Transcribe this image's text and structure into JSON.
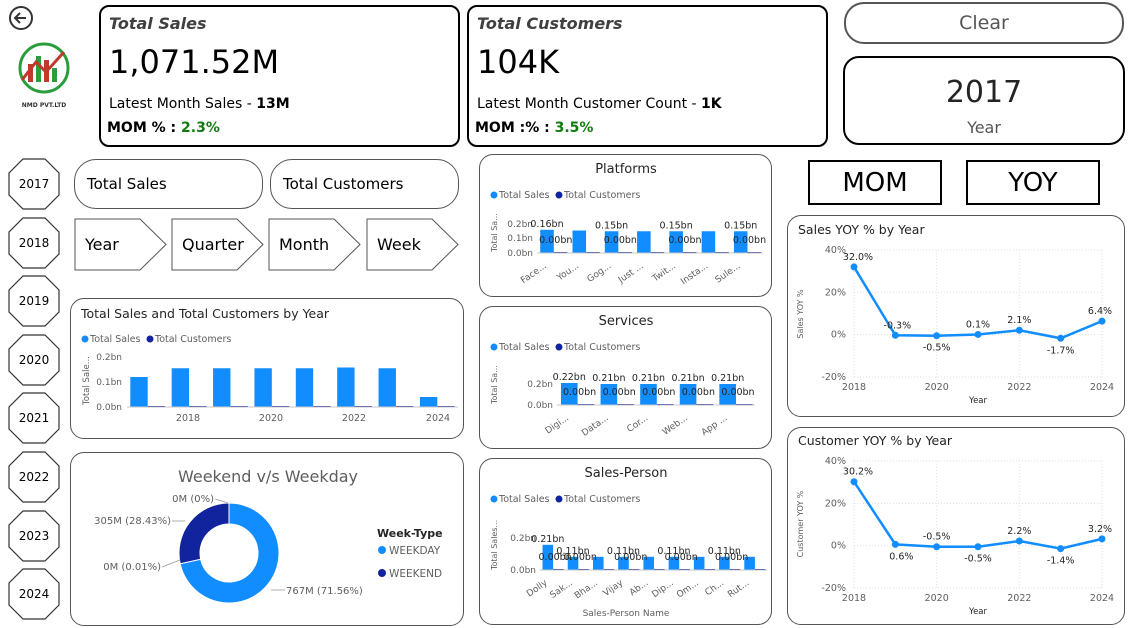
{
  "back_icon": "back-arrow-icon",
  "logo": {
    "text": "NMD PVT.LTD"
  },
  "kpi_sales": {
    "title": "Total Sales",
    "value": "1,071.52M",
    "sub_label": "Latest Month Sales - ",
    "sub_value": "13M",
    "mom_label": "MOM % : ",
    "mom_value": "2.3%"
  },
  "kpi_customers": {
    "title": "Total Customers",
    "value": "104K",
    "sub_label": "Latest Month Customer Count - ",
    "sub_value": "1K",
    "mom_label": "MOM :% : ",
    "mom_value": "3.5%"
  },
  "clear_label": "Clear",
  "year_card": {
    "value": "2017",
    "label": "Year"
  },
  "years": [
    "2017",
    "2018",
    "2019",
    "2020",
    "2021",
    "2022",
    "2023",
    "2024"
  ],
  "measure_buttons": [
    "Total Sales",
    "Total Customers"
  ],
  "period_buttons": [
    "Year",
    "Quarter",
    "Month",
    "Week"
  ],
  "mom_label": "MOM",
  "yoy_label": "YOY",
  "colors": {
    "sales": "#118DFF",
    "customers": "#12239E"
  },
  "legend": {
    "sales": "Total Sales",
    "customers": "Total Customers"
  },
  "chart_data": [
    {
      "id": "by_year",
      "type": "bar",
      "title": "Total Sales and Total Customers by Year",
      "ylabel": "Total Sale...",
      "yticks": [
        "0.2bn",
        "0.1bn",
        "0.0bn"
      ],
      "xticks": [
        "2018",
        "2020",
        "2022",
        "2024"
      ],
      "categories": [
        "2017",
        "2018",
        "2019",
        "2020",
        "2021",
        "2022",
        "2023",
        "2024"
      ],
      "series": [
        {
          "name": "Total Sales",
          "values": [
            0.12,
            0.155,
            0.155,
            0.155,
            0.155,
            0.158,
            0.155,
            0.04
          ]
        },
        {
          "name": "Total Customers",
          "values": [
            0.001,
            0.001,
            0.001,
            0.001,
            0.001,
            0.001,
            0.001,
            0.001
          ]
        }
      ],
      "ylim": [
        0,
        0.2
      ]
    },
    {
      "id": "platforms",
      "type": "bar",
      "title": "Platforms",
      "ylabel": "Total Sa...",
      "yticks": [
        "0.2bn",
        "0.1bn",
        "0.0bn"
      ],
      "categories": [
        "Face...",
        "You...",
        "Gog...",
        "Just ...",
        "Twit...",
        "Insta...",
        "Sule..."
      ],
      "sales_labels": [
        "0.16bn",
        "0.15bn",
        "0.15bn",
        "0.15bn"
      ],
      "cust_labels": [
        "0.00bn",
        "0.00bn",
        "0.00bn",
        "0.00bn"
      ],
      "series": [
        {
          "name": "Total Sales",
          "values": [
            0.16,
            0.155,
            0.15,
            0.15,
            0.15,
            0.15,
            0.15
          ]
        },
        {
          "name": "Total Customers",
          "values": [
            0.001,
            0.001,
            0.001,
            0.001,
            0.001,
            0.001,
            0.001
          ]
        }
      ],
      "ylim": [
        0,
        0.2
      ]
    },
    {
      "id": "services",
      "type": "bar",
      "title": "Services",
      "ylabel": "Total Sa...",
      "yticks": [
        "0.2bn",
        "0.0bn"
      ],
      "categories": [
        "Digi...",
        "Data...",
        "Cor...",
        "Web...",
        "App ..."
      ],
      "sales_labels": [
        "0.22bn",
        "0.21bn",
        "0.21bn",
        "0.21bn",
        "0.21bn"
      ],
      "cust_labels": [
        "0.00bn",
        "0.00bn",
        "0.00bn",
        "0.00bn",
        "0.00bn"
      ],
      "series": [
        {
          "name": "Total Sales",
          "values": [
            0.22,
            0.21,
            0.21,
            0.21,
            0.21
          ]
        },
        {
          "name": "Total Customers",
          "values": [
            0.001,
            0.001,
            0.001,
            0.001,
            0.001
          ]
        }
      ],
      "ylim": [
        0,
        0.25
      ]
    },
    {
      "id": "sales_person",
      "type": "bar",
      "title": "Sales-Person",
      "ylabel": "Total Sales...",
      "xlabel": "Sales-Person Name",
      "yticks": [
        "0.2bn",
        "0.0bn"
      ],
      "categories": [
        "Dolly",
        "Sak...",
        "Bha...",
        "Vijay",
        "Ab...",
        "Dip...",
        "Om...",
        "Ch...",
        "Rut..."
      ],
      "sales_labels": [
        "0.21bn",
        "0.11bn",
        "0.11bn",
        "0.11bn",
        "0.11bn"
      ],
      "cust_labels": [
        "0.00bn",
        "0.00bn",
        "0.00bn",
        "0.00bn",
        "0.00bn"
      ],
      "series": [
        {
          "name": "Total Sales",
          "values": [
            0.21,
            0.11,
            0.11,
            0.11,
            0.11,
            0.11,
            0.11,
            0.11,
            0.11
          ]
        },
        {
          "name": "Total Customers",
          "values": [
            0.001,
            0.001,
            0.001,
            0.001,
            0.001,
            0.001,
            0.001,
            0.001,
            0.001
          ]
        }
      ],
      "ylim": [
        0,
        0.25
      ]
    },
    {
      "id": "weekend",
      "type": "pie",
      "title": "Weekend v/s Weekday",
      "legend_title": "Week-Type",
      "slices": [
        {
          "name": "WEEKDAY",
          "value": 71.56,
          "label": "767M (71.56%)",
          "color": "#118DFF"
        },
        {
          "name": "WEEKEND",
          "value": 28.43,
          "label": "305M (28.43%)",
          "color": "#12239E"
        }
      ],
      "extra_labels": [
        "0M (0%)",
        "0M (0.01%)"
      ]
    },
    {
      "id": "sales_yoy",
      "type": "line",
      "title": "Sales YOY % by Year",
      "ylabel": "Sales YOY %",
      "xlabel": "Year",
      "yticks": [
        "40%",
        "20%",
        "0%",
        "-20%"
      ],
      "xticks": [
        "2018",
        "2020",
        "2022",
        "2024"
      ],
      "x": [
        2018,
        2019,
        2020,
        2021,
        2022,
        2023,
        2024
      ],
      "values": [
        32.0,
        -0.3,
        -0.5,
        0.1,
        2.1,
        -1.7,
        6.4
      ],
      "labels": [
        "32.0%",
        "-0.3%",
        "-0.5%",
        "0.1%",
        "2.1%",
        "-1.7%",
        "6.4%"
      ],
      "ylim": [
        -20,
        40
      ]
    },
    {
      "id": "cust_yoy",
      "type": "line",
      "title": "Customer YOY % by Year",
      "ylabel": "Customer YOY %",
      "xlabel": "Year",
      "yticks": [
        "40%",
        "20%",
        "0%",
        "-20%"
      ],
      "xticks": [
        "2018",
        "2020",
        "2022",
        "2024"
      ],
      "x": [
        2018,
        2019,
        2020,
        2021,
        2022,
        2023,
        2024
      ],
      "values": [
        30.2,
        0.6,
        -0.5,
        -0.5,
        2.2,
        -1.4,
        3.2
      ],
      "labels": [
        "30.2%",
        "0.6%",
        "-0.5%",
        "-0.5%",
        "2.2%",
        "-1.4%",
        "3.2%"
      ],
      "ylim": [
        -20,
        40
      ]
    }
  ]
}
